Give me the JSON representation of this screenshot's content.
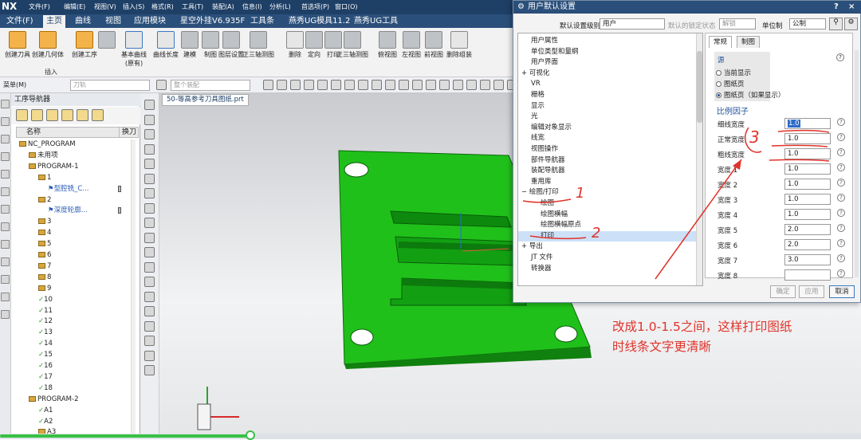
{
  "titlebar": {
    "logo": "NX",
    "menus": [
      "文件(F)",
      "编辑(E)",
      "视图(V)",
      "插入(S)",
      "格式(R)",
      "工具(T)",
      "装配(A)",
      "信息(I)",
      "分析(L)",
      "首选项(P)",
      "窗口(O)"
    ]
  },
  "ribbon_tabs": [
    "文件(F)",
    "主页",
    "曲线",
    "视图",
    "应用模块",
    "星空外挂V6.935F",
    "工具条",
    "燕秀UG模具11.2",
    "燕秀UG工具"
  ],
  "ribbon_buttons": [
    "创建刀具",
    "创建几何体",
    "创建工序",
    "",
    "基本曲线\n(原有)",
    "曲线长度",
    "建模",
    "制图",
    "图层设置",
    "正三轴测图",
    "删除",
    "定向",
    "打印",
    "正三轴测图",
    "俯视图",
    "左视图",
    "前视图",
    "删除组装"
  ],
  "ribbon_group_label": "插入",
  "toolbar": {
    "menu_label": "菜单(M)",
    "select1_placeholder": "刀轨",
    "select2_placeholder": "整个装配"
  },
  "navigator": {
    "title": "工序导航器",
    "col_name": "名称",
    "col_tool": "换刀",
    "rows": [
      {
        "text": "NC_PROGRAM",
        "indent": 0,
        "type": "root"
      },
      {
        "text": "未用项",
        "indent": 1,
        "type": "folder"
      },
      {
        "text": "PROGRAM-1",
        "indent": 1,
        "type": "folder"
      },
      {
        "text": "1",
        "indent": 2,
        "type": "folder"
      },
      {
        "text": "型腔铣_C...",
        "indent": 3,
        "type": "op"
      },
      {
        "text": "2",
        "indent": 2,
        "type": "folder"
      },
      {
        "text": "深度轮廓...",
        "indent": 3,
        "type": "op"
      },
      {
        "text": "3",
        "indent": 2,
        "type": "folder"
      },
      {
        "text": "4",
        "indent": 2,
        "type": "folder"
      },
      {
        "text": "5",
        "indent": 2,
        "type": "folder"
      },
      {
        "text": "6",
        "indent": 2,
        "type": "folder"
      },
      {
        "text": "7",
        "indent": 2,
        "type": "folder"
      },
      {
        "text": "8",
        "indent": 2,
        "type": "folder"
      },
      {
        "text": "9",
        "indent": 2,
        "type": "folder"
      },
      {
        "text": "10",
        "indent": 2,
        "type": "check"
      },
      {
        "text": "11",
        "indent": 2,
        "type": "check"
      },
      {
        "text": "12",
        "indent": 2,
        "type": "check"
      },
      {
        "text": "13",
        "indent": 2,
        "type": "check"
      },
      {
        "text": "14",
        "indent": 2,
        "type": "check"
      },
      {
        "text": "15",
        "indent": 2,
        "type": "check"
      },
      {
        "text": "16",
        "indent": 2,
        "type": "check"
      },
      {
        "text": "17",
        "indent": 2,
        "type": "check"
      },
      {
        "text": "18",
        "indent": 2,
        "type": "check"
      },
      {
        "text": "PROGRAM-2",
        "indent": 1,
        "type": "folder"
      },
      {
        "text": "A1",
        "indent": 2,
        "type": "check"
      },
      {
        "text": "A2",
        "indent": 2,
        "type": "check"
      },
      {
        "text": "A3",
        "indent": 2,
        "type": "folder"
      }
    ]
  },
  "document_tab": "50-等高参考刀具图纸.prt",
  "dialog": {
    "title": "用户默认设置",
    "level_label": "默认设置级别",
    "level_value": "用户",
    "lock_label": "默认的锁定状态",
    "lock_value": "解锁",
    "unit_label": "单位制",
    "unit_value": "公制",
    "tree": [
      {
        "text": "用户属性",
        "indent": 1,
        "sel": false
      },
      {
        "text": "单位类型和量纲",
        "indent": 1,
        "sel": false
      },
      {
        "text": "用户界面",
        "indent": 1,
        "sel": false
      },
      {
        "text": "可视化",
        "indent": 0,
        "expander": "+",
        "sel": false
      },
      {
        "text": "VR",
        "indent": 1,
        "sel": false
      },
      {
        "text": "栅格",
        "indent": 1,
        "sel": false
      },
      {
        "text": "显示",
        "indent": 1,
        "sel": false
      },
      {
        "text": "光",
        "indent": 1,
        "sel": false
      },
      {
        "text": "编辑对象显示",
        "indent": 1,
        "sel": false
      },
      {
        "text": "线宽",
        "indent": 1,
        "sel": false
      },
      {
        "text": "视图操作",
        "indent": 1,
        "sel": false
      },
      {
        "text": "部件导航器",
        "indent": 1,
        "sel": false
      },
      {
        "text": "装配导航器",
        "indent": 1,
        "sel": false
      },
      {
        "text": "重用库",
        "indent": 1,
        "sel": false
      },
      {
        "text": "绘图/打印",
        "indent": 0,
        "expander": "−",
        "sel": false
      },
      {
        "text": "绘图",
        "indent": 2,
        "sel": false
      },
      {
        "text": "绘图横幅",
        "indent": 2,
        "sel": false
      },
      {
        "text": "绘图横幅原点",
        "indent": 2,
        "sel": false
      },
      {
        "text": "打印",
        "indent": 2,
        "sel": true
      },
      {
        "text": "导出",
        "indent": 0,
        "expander": "+",
        "sel": false
      },
      {
        "text": "JT 文件",
        "indent": 1,
        "sel": false
      },
      {
        "text": "转换器",
        "indent": 1,
        "sel": false
      }
    ],
    "tabs": [
      "常规",
      "制图"
    ],
    "source_heading": "源",
    "source_options": [
      "当前显示",
      "图纸页",
      "图纸页（如果显示）"
    ],
    "scale_heading": "比例因子",
    "fields": [
      {
        "label": "细线宽度",
        "value": "1.0"
      },
      {
        "label": "正常宽度",
        "value": "1.0"
      },
      {
        "label": "粗线宽度",
        "value": "1.0"
      },
      {
        "label": "宽度 1",
        "value": "1.0"
      },
      {
        "label": "宽度 2",
        "value": "1.0"
      },
      {
        "label": "宽度 3",
        "value": "1.0"
      },
      {
        "label": "宽度 4",
        "value": "1.0"
      },
      {
        "label": "宽度 5",
        "value": "2.0"
      },
      {
        "label": "宽度 6",
        "value": "2.0"
      },
      {
        "label": "宽度 7",
        "value": "3.0"
      },
      {
        "label": "宽度 8",
        "value": ""
      }
    ],
    "buttons": {
      "ok": "确定",
      "apply": "应用",
      "cancel": "取消"
    }
  },
  "annotations": {
    "marker1": "1",
    "marker2": "2",
    "marker3": "3",
    "note_line1": "改成1.0-1.5之间，这样打印图纸",
    "note_line2": "时线条文字更清晰"
  },
  "colors": {
    "titlebar": "#1e3f66",
    "part_green": "#1db314",
    "annotation_red": "#e0332b",
    "selection_blue": "#cce0f7"
  }
}
